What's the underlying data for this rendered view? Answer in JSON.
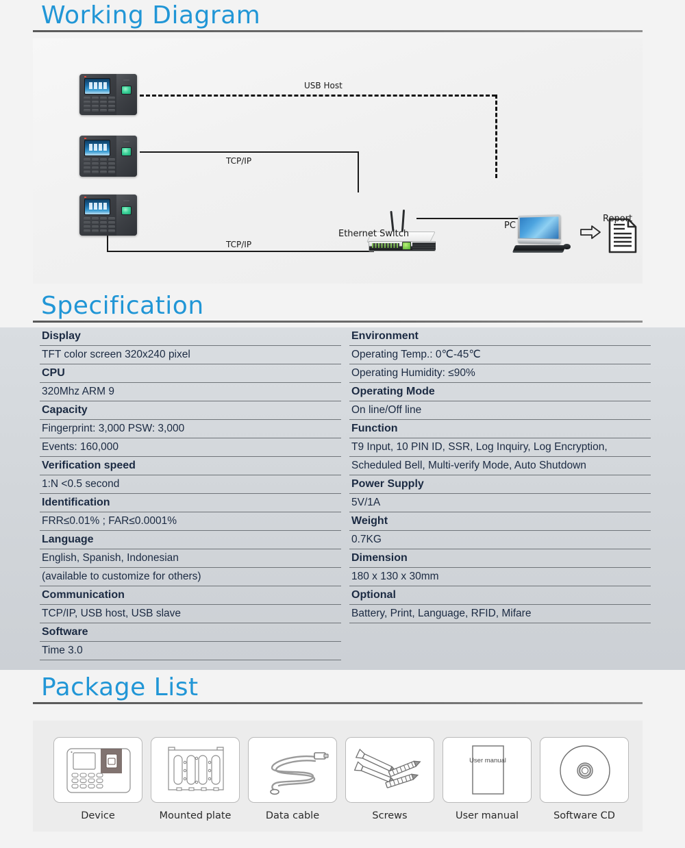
{
  "sections": {
    "working_diagram": {
      "title": "Working Diagram"
    },
    "specification": {
      "title": "Specification"
    },
    "package_list": {
      "title": "Package List"
    }
  },
  "diagram": {
    "labels": {
      "usb_host": "USB Host",
      "tcpip_top": "TCP/IP",
      "tcpip_bottom": "TCP/IP",
      "ethernet_switch": "Ethernet Switch",
      "pc": "PC",
      "report": "Report"
    },
    "devices": [
      {
        "name": "fingerprint-terminal-1"
      },
      {
        "name": "fingerprint-terminal-2"
      },
      {
        "name": "fingerprint-terminal-3"
      }
    ]
  },
  "spec": {
    "left": [
      {
        "type": "head",
        "text": "Display"
      },
      {
        "type": "value",
        "text": "TFT color screen 320x240 pixel"
      },
      {
        "type": "head",
        "text": "CPU"
      },
      {
        "type": "value",
        "text": "320Mhz ARM 9"
      },
      {
        "type": "head",
        "text": "Capacity"
      },
      {
        "type": "value",
        "text": "Fingerprint: 3,000   PSW: 3,000"
      },
      {
        "type": "value",
        "text": "Events: 160,000"
      },
      {
        "type": "head",
        "text": "Verification speed"
      },
      {
        "type": "value",
        "text": "1:N <0.5 second"
      },
      {
        "type": "head",
        "text": "Identification"
      },
      {
        "type": "value",
        "text": "FRR≤0.01% ; FAR≤0.0001%"
      },
      {
        "type": "head",
        "text": "Language"
      },
      {
        "type": "value",
        "text": "English, Spanish, Indonesian"
      },
      {
        "type": "value",
        "text": "(available to customize for others)"
      },
      {
        "type": "head",
        "text": "Communication"
      },
      {
        "type": "value",
        "text": "TCP/IP, USB host, USB slave"
      },
      {
        "type": "head",
        "text": "Software"
      },
      {
        "type": "value",
        "text": "Time 3.0"
      }
    ],
    "right": [
      {
        "type": "head",
        "text": "Environment"
      },
      {
        "type": "value",
        "text": "Operating Temp.: 0℃-45℃"
      },
      {
        "type": "value",
        "text": "Operating Humidity: ≤90%"
      },
      {
        "type": "head",
        "text": "Operating Mode"
      },
      {
        "type": "value",
        "text": "On line/Off line"
      },
      {
        "type": "head",
        "text": "Function"
      },
      {
        "type": "value",
        "text": "T9 Input, 10 PIN ID, SSR, Log Inquiry, Log Encryption,"
      },
      {
        "type": "value",
        "text": "Scheduled Bell, Multi-verify Mode, Auto Shutdown"
      },
      {
        "type": "head",
        "text": "Power Supply"
      },
      {
        "type": "value",
        "text": "5V/1A"
      },
      {
        "type": "head",
        "text": "Weight"
      },
      {
        "type": "value",
        "text": "0.7KG"
      },
      {
        "type": "head",
        "text": "Dimension"
      },
      {
        "type": "value",
        "text": "180 x 130 x 30mm"
      },
      {
        "type": "head",
        "text": "Optional"
      },
      {
        "type": "value",
        "text": "Battery, Print, Language, RFID, Mifare"
      }
    ]
  },
  "package": {
    "items": [
      {
        "icon": "device-icon",
        "label": "Device"
      },
      {
        "icon": "mounted-plate-icon",
        "label": "Mounted plate"
      },
      {
        "icon": "data-cable-icon",
        "label": "Data cable"
      },
      {
        "icon": "screws-icon",
        "label": "Screws"
      },
      {
        "icon": "user-manual-icon",
        "label": "User manual",
        "cover_text": "User manual"
      },
      {
        "icon": "software-cd-icon",
        "label": "Software CD"
      }
    ]
  },
  "colors": {
    "accent": "#2196d6",
    "spec_bg": "#d4d8dc",
    "spec_text": "#1b2a42",
    "rule": "#6f7479"
  }
}
